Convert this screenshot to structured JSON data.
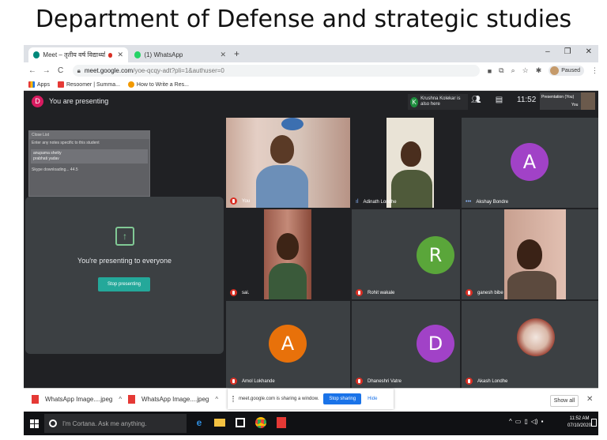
{
  "slide": {
    "title": "Department of Defense and strategic studies"
  },
  "browser": {
    "tabs": [
      {
        "label": "Meet – तृतीय वर्ष विद्यार्थ्यांसाठी",
        "active": true
      },
      {
        "label": "(1) WhatsApp",
        "active": false
      }
    ],
    "url_host": "meet.google.com",
    "url_path": "/yoe-qcqy-adt?pli=1&authuser=0",
    "profile_label": "Paused",
    "bookmarks": [
      "Apps",
      "Resoomer | Summa...",
      "How to Write a Res..."
    ]
  },
  "meet": {
    "presenting_label": "You are presenting",
    "presenter_initial": "D",
    "host_notice": {
      "initial": "K",
      "text": "Krushna Kolekar is also here"
    },
    "clock": "11:52",
    "self_tile_label": "Presentation (You)",
    "self_tile_you": "You",
    "mini_window": {
      "title": "Close List",
      "text": "Enter any notes specific to this student",
      "names": [
        "anupama shetty",
        "prabhati yadav"
      ],
      "footer": "Skype downloading... 44.5"
    },
    "presenting_message": "You're presenting to everyone",
    "stop_presenting": "Stop presenting",
    "participants": [
      {
        "name": "You",
        "type": "photo"
      },
      {
        "name": "Adinath Londhe",
        "type": "photo"
      },
      {
        "name": "Akshay Bondre",
        "type": "avatar",
        "initial": "A",
        "color": "#a142c7"
      },
      {
        "name": "sai.",
        "type": "photo"
      },
      {
        "name": "Rohit wakale",
        "type": "avatar",
        "initial": "R",
        "color": "#5aa63a"
      },
      {
        "name": "ganesh bibe",
        "type": "photo"
      },
      {
        "name": "Amol Lokhande",
        "type": "avatar",
        "initial": "A",
        "color": "#e8710a"
      },
      {
        "name": "Dhaneshri Vatre",
        "type": "avatar",
        "initial": "D",
        "color": "#a142c7"
      },
      {
        "name": "Akash Londhe",
        "type": "photo"
      }
    ]
  },
  "downloads": {
    "items": [
      "WhatsApp Image....jpeg",
      "WhatsApp Image....jpeg"
    ],
    "sharing_text": "meet.google.com is sharing a window.",
    "stop_sharing": "Stop sharing",
    "hide": "Hide",
    "show_all": "Show all"
  },
  "taskbar": {
    "cortana": "I'm Cortana. Ask me anything.",
    "time": "11:52 AM",
    "date": "07/10/2020"
  },
  "colors": {
    "meet_bg": "#202124",
    "stop_btn": "#24a89a",
    "share_btn": "#1a73e8"
  }
}
